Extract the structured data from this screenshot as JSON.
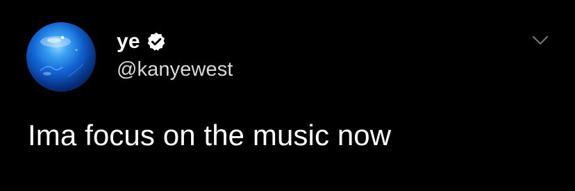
{
  "tweet": {
    "author": {
      "display_name": "ye",
      "handle": "@kanyewest",
      "verified": true,
      "avatar": "blue-sphere-avatar"
    },
    "text": "Ima focus on the music now",
    "menu_icon": "chevron-down-icon",
    "verified_icon": "verified-badge-icon"
  },
  "colors": {
    "background": "#000000",
    "text_primary": "#ffffff",
    "text_secondary": "#d9d9d9",
    "chevron": "#6e767d"
  }
}
